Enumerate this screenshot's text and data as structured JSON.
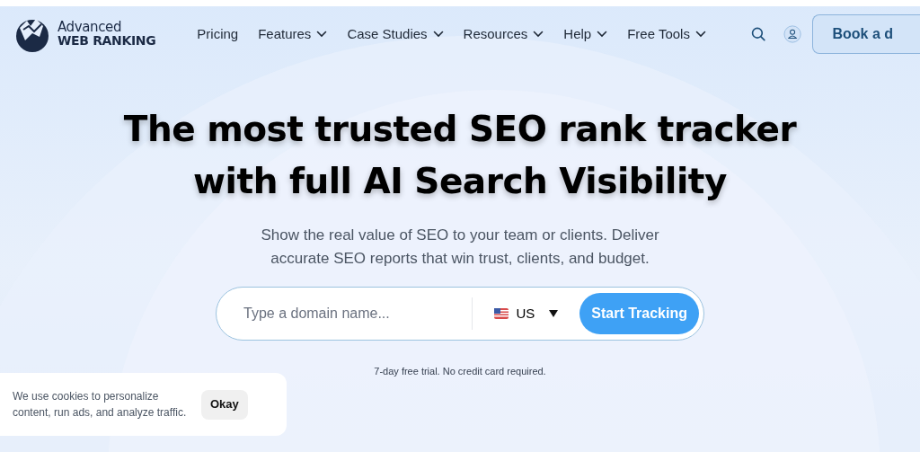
{
  "logo": {
    "line_1": "Advanced",
    "line_2": "WEB RANKING"
  },
  "nav": [
    {
      "label": "Pricing",
      "dropdown": false
    },
    {
      "label": "Features",
      "dropdown": true
    },
    {
      "label": "Case Studies",
      "dropdown": true
    },
    {
      "label": "Resources",
      "dropdown": true
    },
    {
      "label": "Help",
      "dropdown": true
    },
    {
      "label": "Free Tools",
      "dropdown": true
    }
  ],
  "cta_button": "Book a d",
  "hero": {
    "title_lines": [
      "The most trusted SEO rank tracker",
      "with full AI Search Visibility"
    ],
    "subtitle_lines": [
      "Show the real value of SEO to your team or clients. Deliver",
      "accurate SEO reports that win trust, clients, and budget."
    ],
    "search": {
      "placeholder": "Type a domain name...",
      "country": "US",
      "button": "Start Tracking"
    },
    "note": "7-day free trial. No credit card required."
  },
  "cookie_banner": {
    "text": "We use cookies to personalize content, run ads, and analyze traffic.",
    "button": "Okay"
  }
}
